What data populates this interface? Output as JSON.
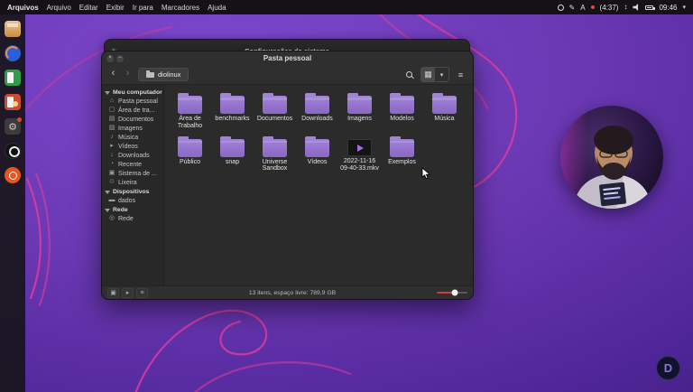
{
  "topbar": {
    "app_name": "Arquivos",
    "menus": [
      "Arquivo",
      "Editar",
      "Exibir",
      "Ir para",
      "Marcadores",
      "Ajuda"
    ],
    "keyboard_indicator": "A",
    "recording_timer": "(4:37)",
    "clock": "09:46"
  },
  "settings_window": {
    "title": "Configurações do sistema"
  },
  "file_manager": {
    "title": "Pasta pessoal",
    "location": "diolinux",
    "sidebar": {
      "sections": [
        {
          "label": "Meu computador",
          "items": [
            "Pasta pessoal",
            "Área de tra...",
            "Documentos",
            "Imagens",
            "Música",
            "Vídeos",
            "Downloads",
            "Recente",
            "Sistema de ...",
            "Lixeira"
          ]
        },
        {
          "label": "Dispositivos",
          "items": [
            "dados"
          ]
        },
        {
          "label": "Rede",
          "items": [
            "Rede"
          ]
        }
      ]
    },
    "files": [
      {
        "label": "Área de Trabalho",
        "type": "folder"
      },
      {
        "label": "benchmarks",
        "type": "folder"
      },
      {
        "label": "Documentos",
        "type": "folder"
      },
      {
        "label": "Downloads",
        "type": "folder"
      },
      {
        "label": "Imagens",
        "type": "folder"
      },
      {
        "label": "Modelos",
        "type": "folder"
      },
      {
        "label": "Música",
        "type": "folder"
      },
      {
        "label": "Público",
        "type": "folder"
      },
      {
        "label": "snap",
        "type": "folder"
      },
      {
        "label": "Universe Sandbox",
        "type": "folder"
      },
      {
        "label": "Vídeos",
        "type": "folder"
      },
      {
        "label": "2022-11-16 09-40-33.mkv",
        "type": "video"
      },
      {
        "label": "Exemplos",
        "type": "folder"
      }
    ],
    "status_text": "13 itens, espaço livre: 789,9 GB",
    "accent_color": "#c94034",
    "folder_color": "#9878d2"
  },
  "branding": {
    "logo_letter": "D"
  }
}
